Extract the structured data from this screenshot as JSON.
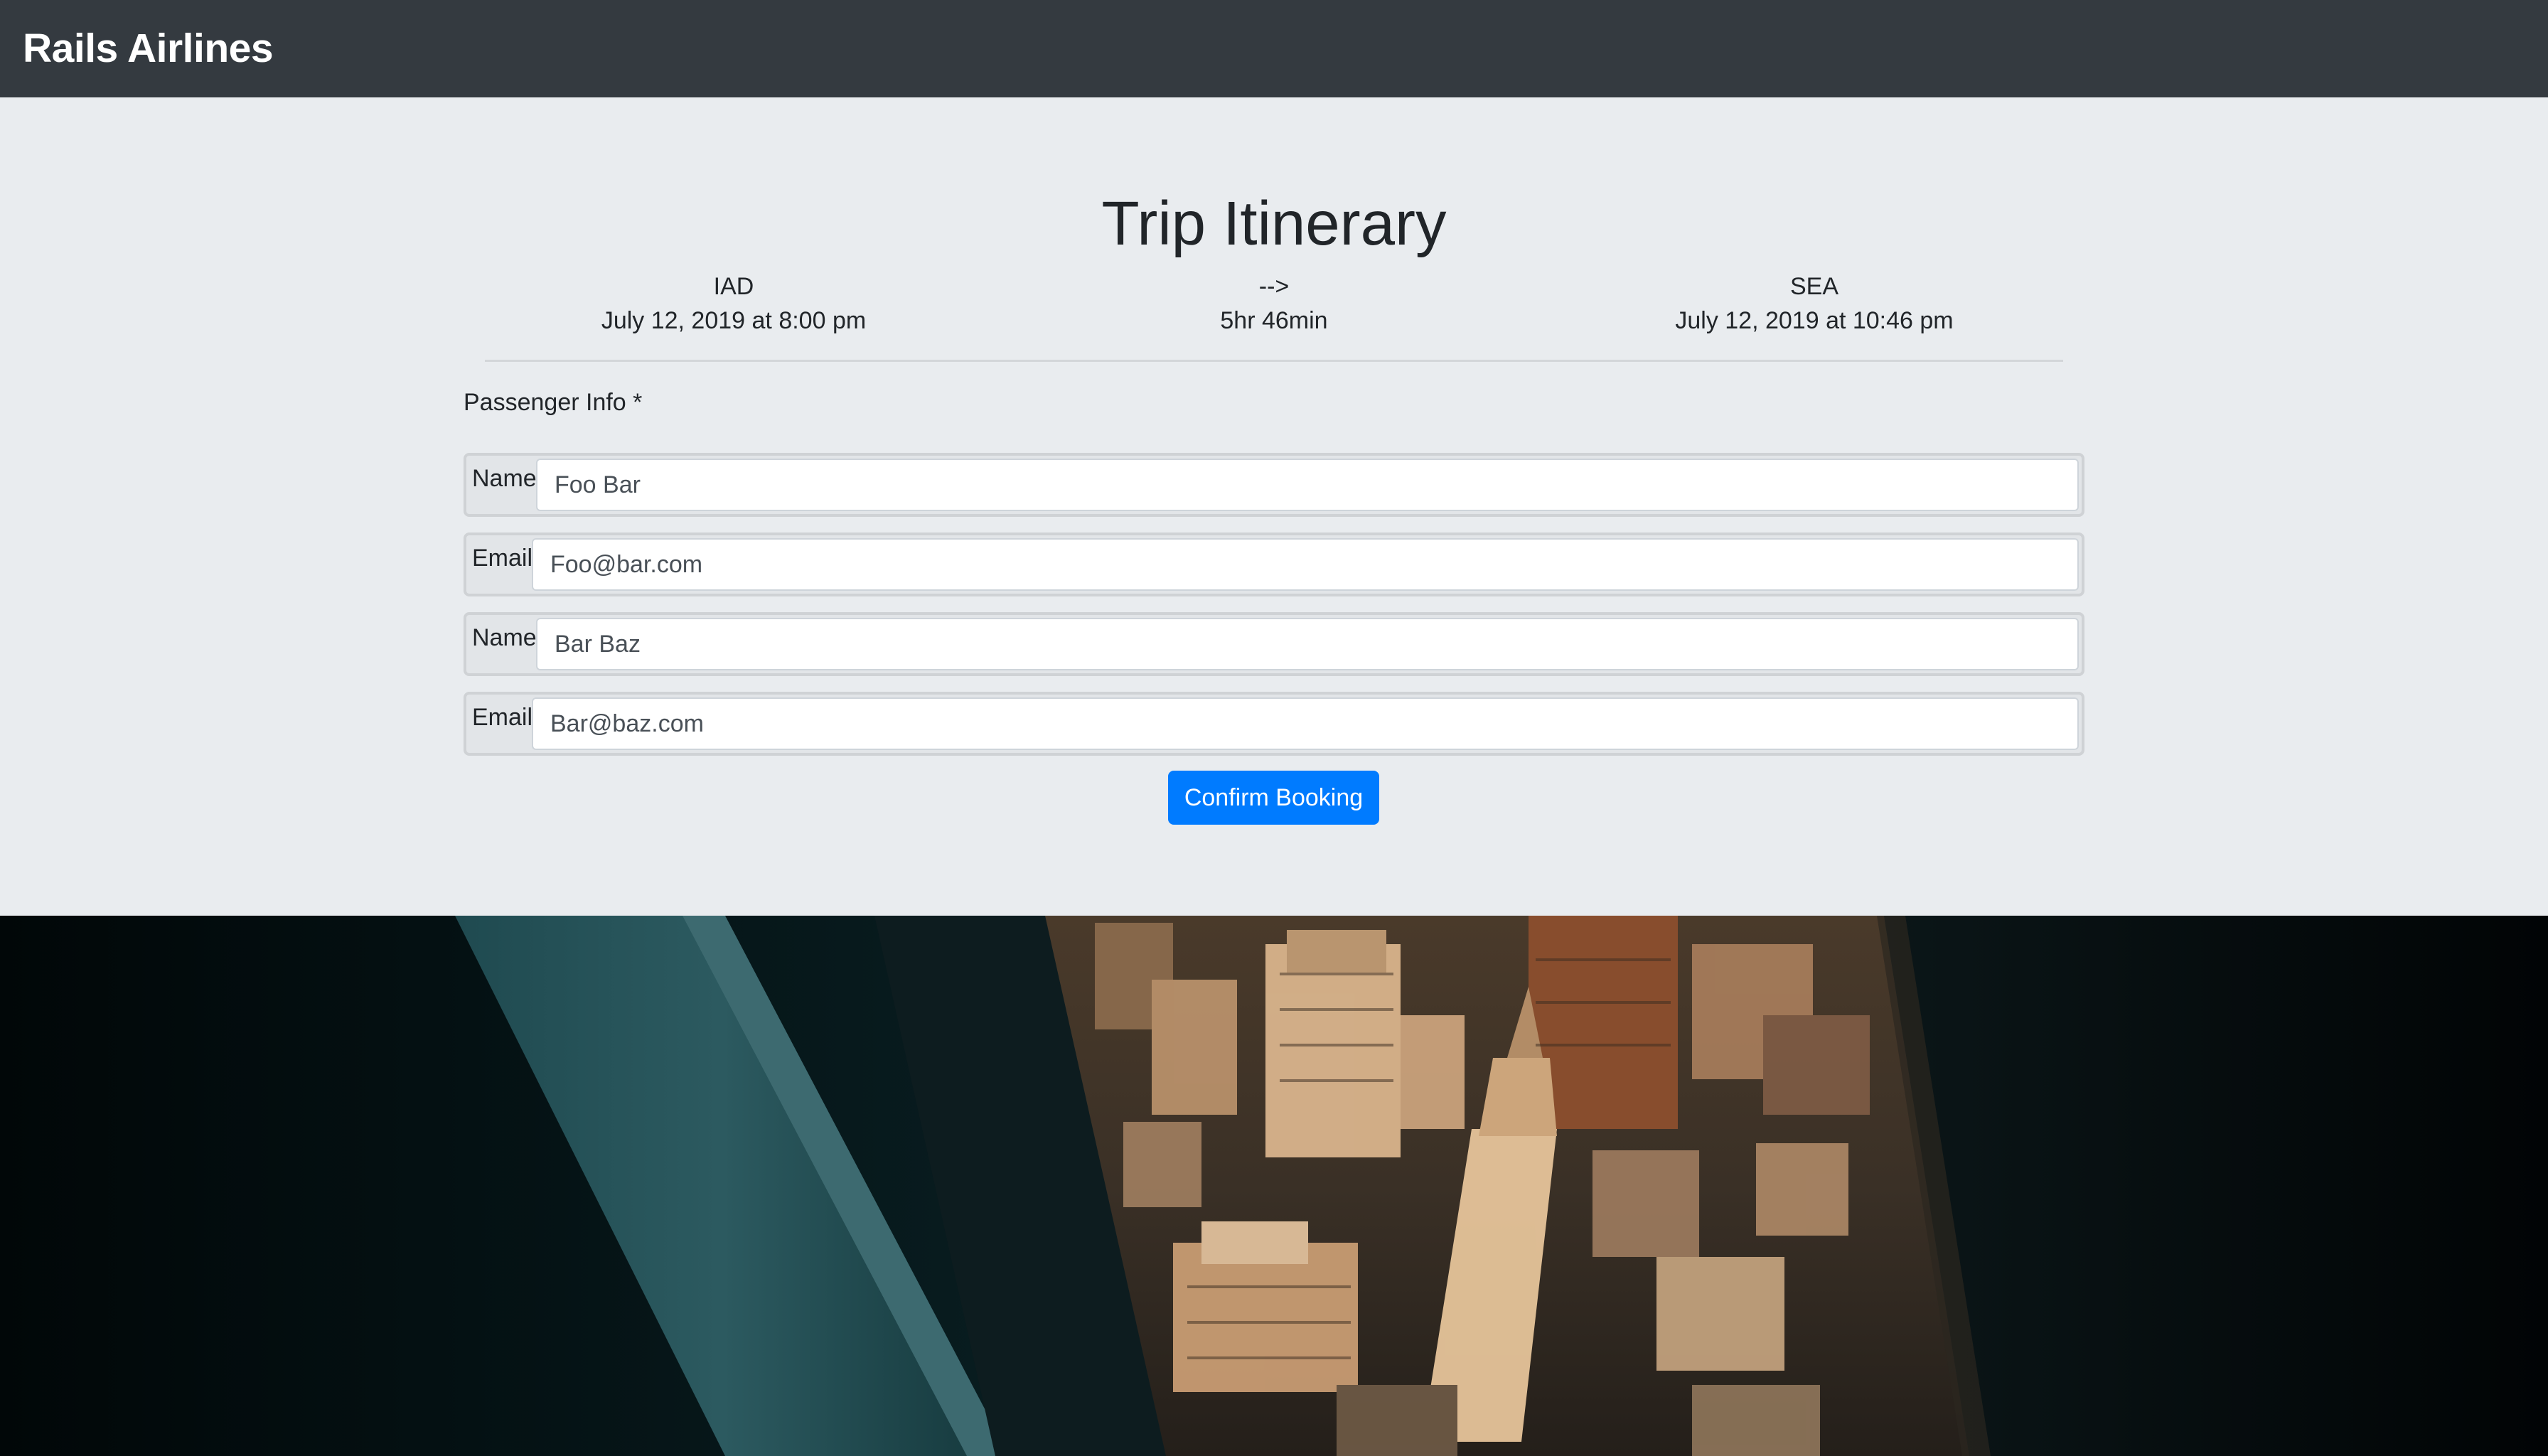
{
  "navbar": {
    "brand": "Rails Airlines"
  },
  "itinerary": {
    "title": "Trip Itinerary",
    "departure": {
      "airport": "IAD",
      "datetime": "July 12, 2019 at 8:00 pm"
    },
    "connector": {
      "arrow": "-->",
      "duration": "5hr 46min"
    },
    "arrival": {
      "airport": "SEA",
      "datetime": "July 12, 2019 at 10:46 pm"
    }
  },
  "passengers": {
    "label": "Passenger Info *",
    "list": [
      {
        "name_label": "Name",
        "name_value": "Foo Bar",
        "email_label": "Email",
        "email_value": "Foo@bar.com"
      },
      {
        "name_label": "Name",
        "name_value": "Bar Baz",
        "email_label": "Email",
        "email_value": "Bar@baz.com"
      }
    ]
  },
  "actions": {
    "confirm_label": "Confirm Booking"
  },
  "colors": {
    "navbar_bg": "#343a40",
    "jumbotron_bg": "#e9ecef",
    "primary": "#007bff"
  },
  "hero_image": {
    "icon": "city-from-airplane-window-image"
  }
}
